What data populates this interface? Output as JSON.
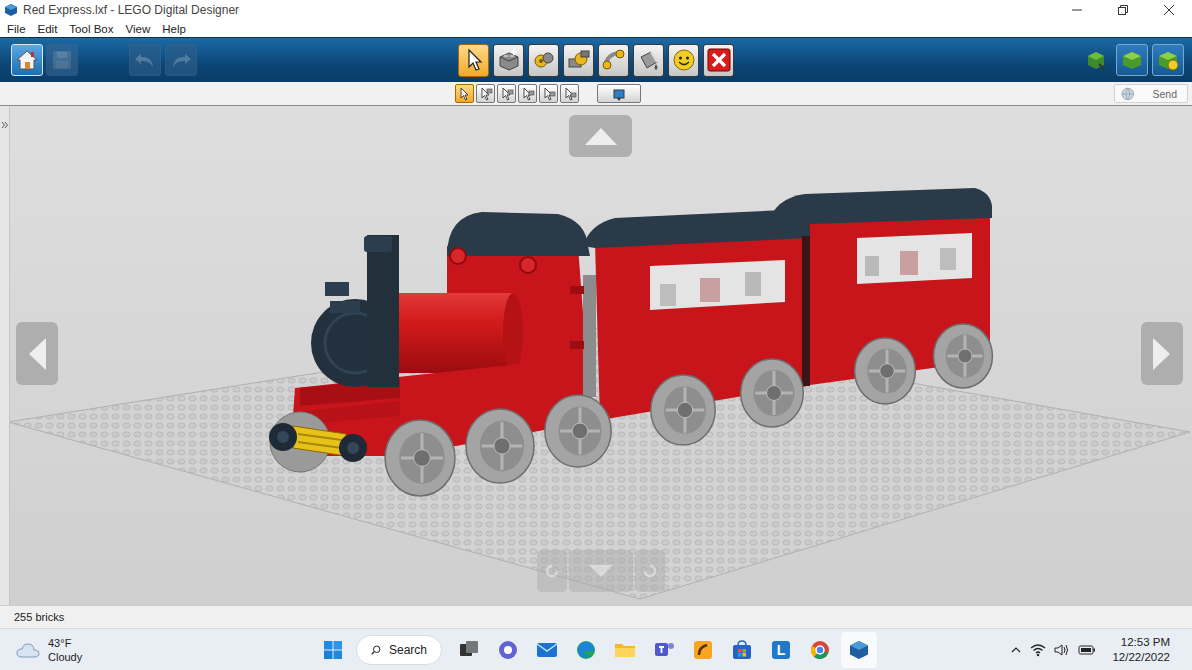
{
  "window": {
    "title": "Red Express.lxf - LEGO Digital Designer"
  },
  "menu": [
    "File",
    "Edit",
    "Tool Box",
    "View",
    "Help"
  ],
  "file_buttons": {
    "save_enabled": false,
    "undo_enabled": false,
    "redo_enabled": false
  },
  "tools": [
    {
      "selected": true
    },
    {
      "selected": false
    },
    {
      "selected": false
    },
    {
      "selected": false
    },
    {
      "selected": false
    },
    {
      "selected": false
    },
    {
      "selected": false
    },
    {
      "selected": false
    }
  ],
  "sub_tools": [
    {
      "selected": true
    },
    {
      "selected": false
    },
    {
      "selected": false
    },
    {
      "selected": false
    },
    {
      "selected": false
    },
    {
      "selected": false
    },
    {
      "selected": false
    }
  ],
  "send_button": {
    "label": "Send"
  },
  "status_bar": {
    "brick_count": "255 bricks"
  },
  "taskbar": {
    "weather": {
      "temperature": "43°F",
      "condition": "Cloudy"
    },
    "search": {
      "placeholder": "Search"
    },
    "app_letter": "L",
    "time": "12:53 PM",
    "date": "12/22/2022"
  }
}
